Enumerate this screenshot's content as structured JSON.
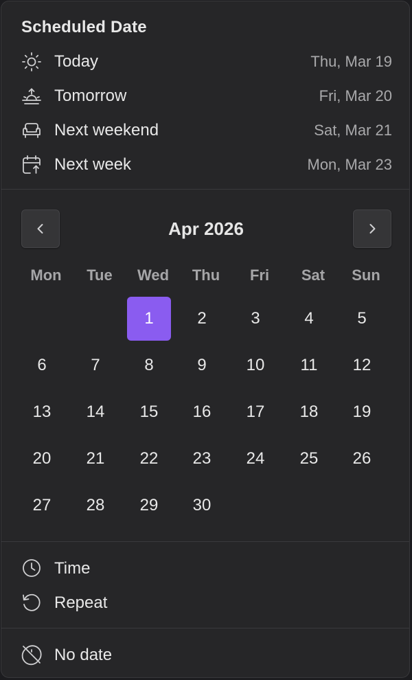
{
  "panel": {
    "title": "Scheduled Date"
  },
  "quick_options": [
    {
      "icon": "sun-icon",
      "label": "Today",
      "date": "Thu, Mar 19"
    },
    {
      "icon": "sunrise-icon",
      "label": "Tomorrow",
      "date": "Fri, Mar 20"
    },
    {
      "icon": "sofa-icon",
      "label": "Next weekend",
      "date": "Sat, Mar 21"
    },
    {
      "icon": "calendar-arrow-icon",
      "label": "Next week",
      "date": "Mon, Mar 23"
    }
  ],
  "calendar": {
    "month_label": "Apr 2026",
    "prev_icon": "chevron-left-icon",
    "next_icon": "chevron-right-icon",
    "weekdays": [
      "Mon",
      "Tue",
      "Wed",
      "Thu",
      "Fri",
      "Sat",
      "Sun"
    ],
    "weeks": [
      [
        "",
        "",
        "1",
        "2",
        "3",
        "4",
        "5"
      ],
      [
        "6",
        "7",
        "8",
        "9",
        "10",
        "11",
        "12"
      ],
      [
        "13",
        "14",
        "15",
        "16",
        "17",
        "18",
        "19"
      ],
      [
        "20",
        "21",
        "22",
        "23",
        "24",
        "25",
        "26"
      ],
      [
        "27",
        "28",
        "29",
        "30",
        "",
        "",
        ""
      ]
    ],
    "selected_day": "1",
    "accent_color": "#8a5cf0"
  },
  "options": [
    {
      "icon": "clock-icon",
      "label": "Time"
    },
    {
      "icon": "repeat-icon",
      "label": "Repeat"
    }
  ],
  "footer": {
    "icon": "no-date-icon",
    "label": "No date"
  }
}
